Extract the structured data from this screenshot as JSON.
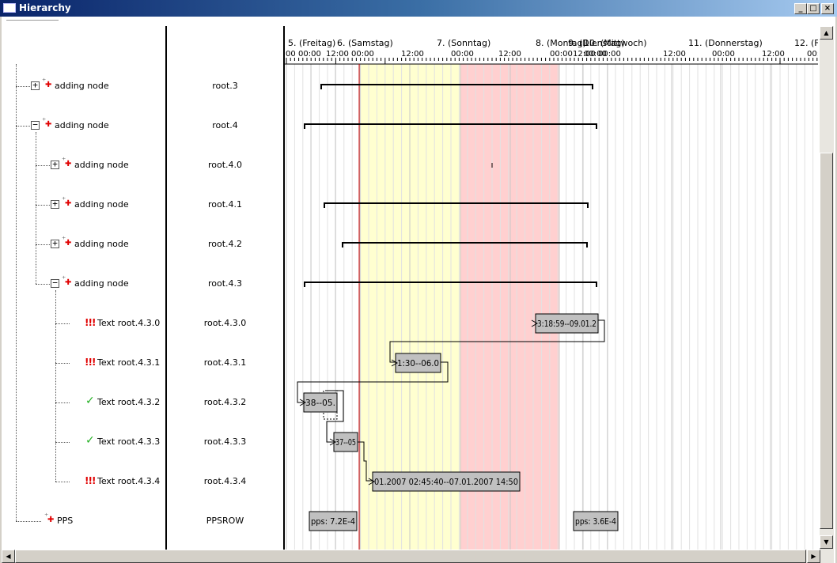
{
  "window": {
    "title": "Hierarchy"
  },
  "caption_buttons": {
    "minimize": "_",
    "maximize": "□",
    "close": "×"
  },
  "tree": {
    "rows": [
      {
        "label": "adding node",
        "id": "root.3",
        "icon": "add-node-icon",
        "expander": "+",
        "level": 1
      },
      {
        "label": "adding node",
        "id": "root.4",
        "icon": "add-node-icon",
        "expander": "−",
        "level": 1
      },
      {
        "label": "adding node",
        "id": "root.4.0",
        "icon": "add-node-icon",
        "expander": "+",
        "level": 2
      },
      {
        "label": "adding node",
        "id": "root.4.1",
        "icon": "add-node-icon",
        "expander": "+",
        "level": 2
      },
      {
        "label": "adding node",
        "id": "root.4.2",
        "icon": "add-node-icon",
        "expander": "+",
        "level": 2
      },
      {
        "label": "adding node",
        "id": "root.4.3",
        "icon": "add-node-icon",
        "expander": "−",
        "level": 2
      },
      {
        "label": "Text root.4.3.0",
        "id": "root.4.3.0",
        "icon": "warning-icon",
        "status": "!!!",
        "level": 3
      },
      {
        "label": "Text root.4.3.1",
        "id": "root.4.3.1",
        "icon": "warning-icon",
        "status": "!!!",
        "level": 3
      },
      {
        "label": "Text root.4.3.2",
        "id": "root.4.3.2",
        "icon": "checkmark-icon",
        "status": "✓",
        "level": 3
      },
      {
        "label": "Text root.4.3.3",
        "id": "root.4.3.3",
        "icon": "checkmark-icon",
        "status": "✓",
        "level": 3
      },
      {
        "label": "Text root.4.3.4",
        "id": "root.4.3.4",
        "icon": "warning-icon",
        "status": "!!!",
        "level": 3
      },
      {
        "label": "PPS",
        "id": "PPSROW",
        "icon": "add-node-icon",
        "level": 1
      }
    ]
  },
  "timeline": {
    "days": [
      {
        "label": "5. (Freitag)"
      },
      {
        "label": "6. (Samstag)"
      },
      {
        "label": "7. (Sonntag)"
      },
      {
        "label": "8. (Montag)"
      },
      {
        "label": "9. (Dienstag)"
      },
      {
        "label": "10. (Mittwoch)"
      },
      {
        "label": "11. (Donnerstag)"
      },
      {
        "label": "12. (Fr"
      }
    ],
    "hour_labels": [
      "00",
      "00:00",
      "12:00",
      "00:00",
      "12:00",
      "00:00",
      "12:00",
      "00:00",
      "12:00",
      "00:00",
      "00:00",
      "12:00",
      "00:00",
      "12:00",
      "00:00"
    ],
    "colors": {
      "weekend_saturday": "#ffffd0",
      "weekend_sunday": "#ffd0d0",
      "now_line": "#cc0000",
      "task_fill": "#c0c0c0"
    }
  },
  "tasks": [
    {
      "row": 6,
      "label": "3:18:59--09.01.2"
    },
    {
      "row": 7,
      "label": "1:30--06.0"
    },
    {
      "row": 8,
      "label": "38--05."
    },
    {
      "row": 9,
      "label": "37--05"
    },
    {
      "row": 10,
      "label": "01.2007 02:45:40--07.01.2007 14:50"
    },
    {
      "row": 11,
      "label": "pps: 7.2E-4"
    },
    {
      "row": 11,
      "label": "pps: 3.6E-4"
    }
  ],
  "scrollbars": {
    "up": "▲",
    "down": "▼",
    "left": "◀",
    "right": "▶"
  }
}
